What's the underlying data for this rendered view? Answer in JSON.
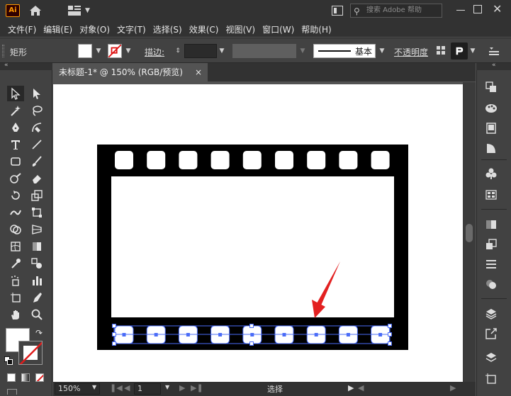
{
  "app": {
    "logo_text": "Ai",
    "search_placeholder": "搜索 Adobe 帮助"
  },
  "menu": [
    "文件(F)",
    "编辑(E)",
    "对象(O)",
    "文字(T)",
    "选择(S)",
    "效果(C)",
    "视图(V)",
    "窗口(W)",
    "帮助(H)"
  ],
  "control_bar": {
    "shape_label": "矩形",
    "stroke_label": "描边",
    "stroke_style_label": "基本",
    "opacity_label": "不透明度",
    "fill_color": "#ffffff"
  },
  "document": {
    "tab_title": "未标题-1* @ 150% (RGB/预览)",
    "close_glyph": "×"
  },
  "status": {
    "zoom": "150%",
    "page": "1",
    "mode": "选择"
  },
  "film": {
    "frame_color": "#000000",
    "hole_color": "#ffffff",
    "selection_color": "#4a6cf7",
    "arrow_color": "#e32121",
    "top_holes": 9,
    "bottom_holes": 9
  }
}
